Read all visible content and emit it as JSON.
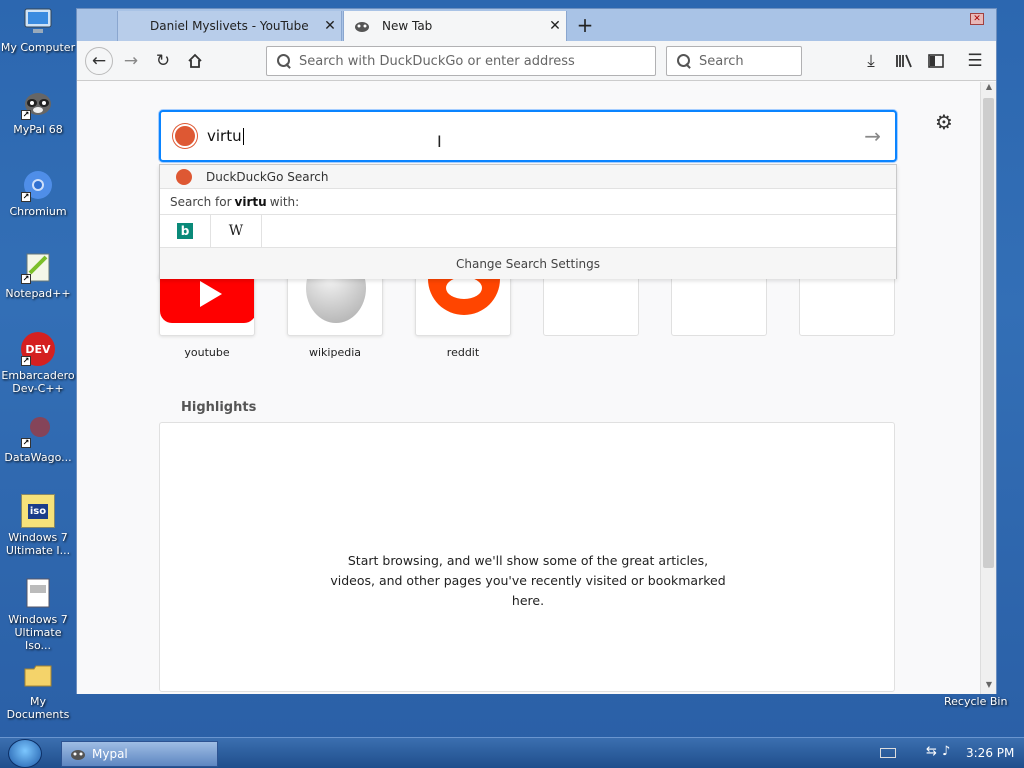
{
  "desktop": {
    "icons": [
      {
        "label": "My Computer"
      },
      {
        "label": "MyPal 68"
      },
      {
        "label": "Chromium"
      },
      {
        "label": "Notepad++"
      },
      {
        "label": "Embarcadero Dev-C++"
      },
      {
        "label": "DataWago..."
      },
      {
        "label": "Windows 7 Ultimate I..."
      },
      {
        "label": "Windows 7 Ultimate Iso..."
      },
      {
        "label": "My Documents"
      }
    ],
    "recycle_bin": "Recycle Bin",
    "dev_icon_text": "DEV",
    "iso_icon_text": "iso"
  },
  "browser": {
    "tabs": [
      {
        "title": "Daniel Myslivets - YouTube",
        "active": false
      },
      {
        "title": "New Tab",
        "active": true
      }
    ],
    "new_tab_icon": "+",
    "url_placeholder": "Search with DuckDuckGo or enter address",
    "search_placeholder": "Search"
  },
  "newtab": {
    "search_value": "virtu",
    "suggestions": {
      "engine_label": "DuckDuckGo Search",
      "search_for_prefix": "Search for",
      "search_term": "virtu",
      "search_for_suffix": "with:",
      "wiki_glyph": "W",
      "bing_glyph": "b",
      "change_settings": "Change Search Settings"
    },
    "top_sites": [
      {
        "label": "youtube"
      },
      {
        "label": "wikipedia"
      },
      {
        "label": "reddit"
      },
      {
        "label": ""
      },
      {
        "label": ""
      },
      {
        "label": ""
      }
    ],
    "highlights_title": "Highlights",
    "highlights_empty": "Start browsing, and we'll show some of the great articles, videos, and other pages you've recently visited or bookmarked here."
  },
  "taskbar": {
    "task_label": "Mypal",
    "clock": "3:26 PM"
  },
  "colors": {
    "accent": "#0a84ff",
    "ddg": "#de5833",
    "youtube": "#ff0000",
    "reddit": "#ff4500"
  }
}
